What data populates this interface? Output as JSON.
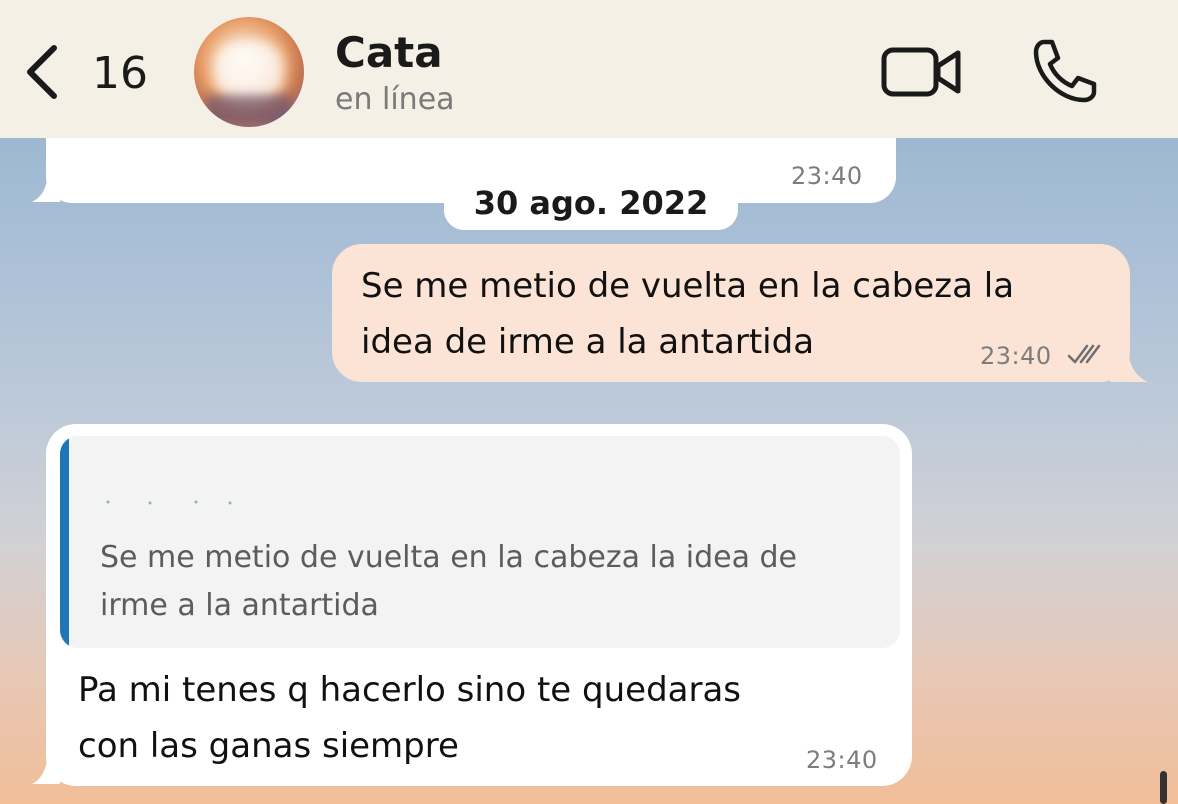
{
  "header": {
    "back_count": "16",
    "contact_name": "Cata",
    "contact_status": "en línea",
    "icons": {
      "back": "chevron-left-icon",
      "video": "video-camera-icon",
      "call": "phone-icon"
    }
  },
  "messages": {
    "previous": {
      "time": "23:40"
    },
    "date_separator": "30 ago. 2022",
    "outgoing": {
      "line1": "Se me metio de vuelta en la cabeza la",
      "line2": "idea de irme a la antartida",
      "time": "23:40",
      "status_icon": "double-check-icon"
    },
    "incoming": {
      "quote": {
        "line1": "Se me metio de vuelta en la cabeza la idea de",
        "line2": "irme a la antartida"
      },
      "line1": "Pa mi tenes q hacerlo sino te quedaras",
      "line2": "con las ganas siempre",
      "time": "23:40"
    }
  },
  "colors": {
    "header_bg": "#f4f0e6",
    "outgoing_bubble": "#fbe3d6",
    "incoming_bubble": "#ffffff",
    "quote_bar": "#1d76b5"
  }
}
